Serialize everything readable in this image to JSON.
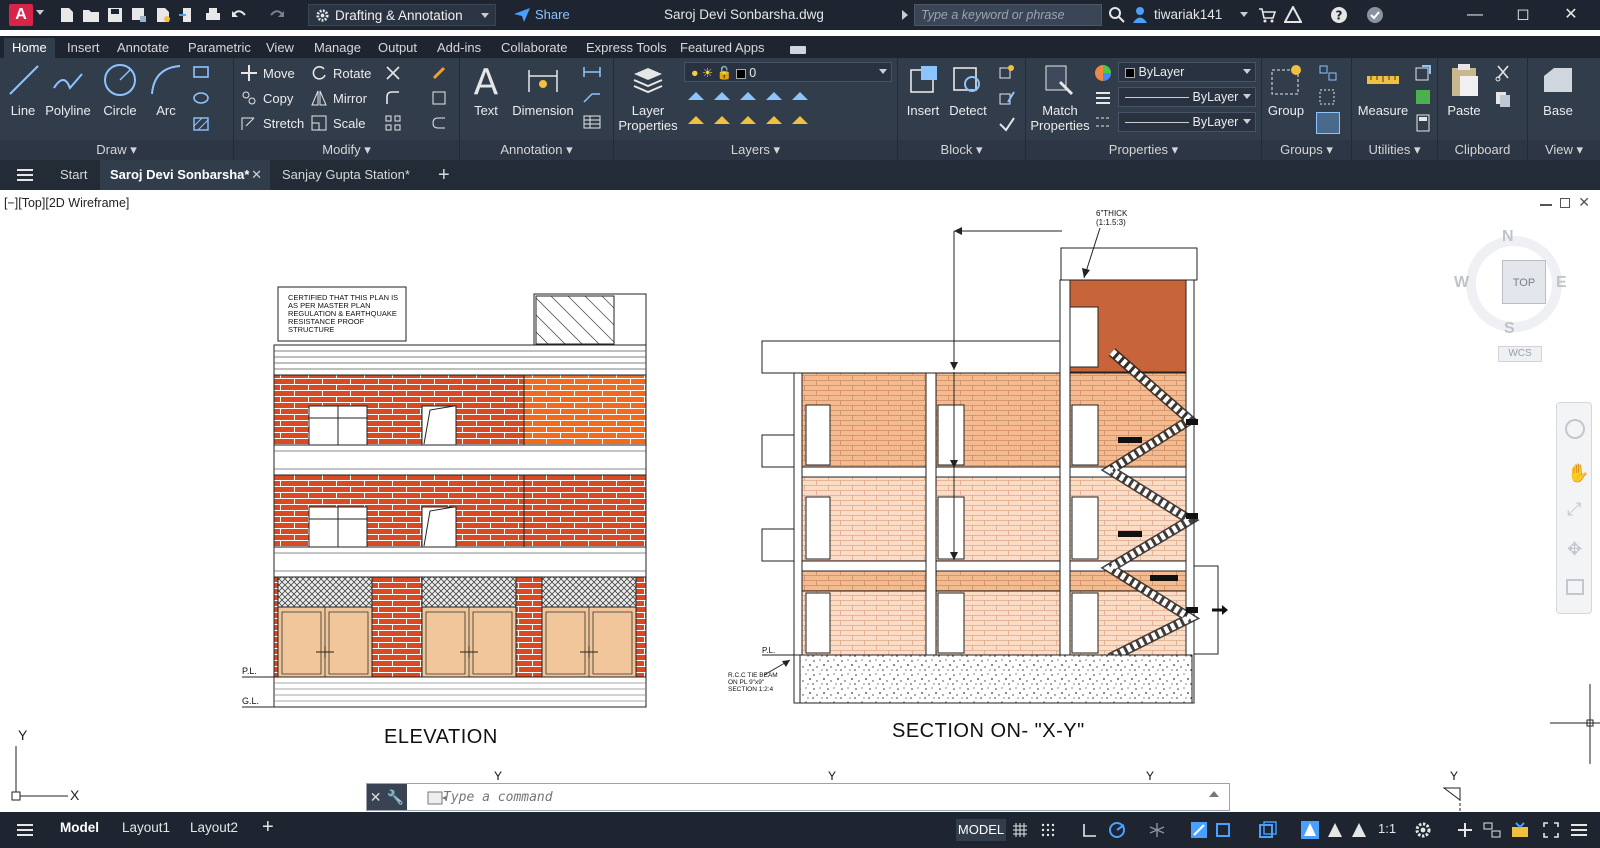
{
  "titlebar": {
    "app_logo": "A",
    "workspace": "Drafting & Annotation",
    "share_label": "Share",
    "document_title": "Saroj Devi Sonbarsha.dwg",
    "search_placeholder": "Type a keyword or phrase",
    "username": "tiwariak141"
  },
  "ribbon_tabs": [
    "Home",
    "Insert",
    "Annotate",
    "Parametric",
    "View",
    "Manage",
    "Output",
    "Add-ins",
    "Collaborate",
    "Express Tools",
    "Featured Apps"
  ],
  "draw": {
    "title": "Draw",
    "line": "Line",
    "polyline": "Polyline",
    "circle": "Circle",
    "arc": "Arc"
  },
  "modify": {
    "title": "Modify",
    "move": "Move",
    "rotate": "Rotate",
    "copy": "Copy",
    "mirror": "Mirror",
    "stretch": "Stretch",
    "scale": "Scale"
  },
  "annotation": {
    "title": "Annotation",
    "text": "Text",
    "dimension": "Dimension"
  },
  "layers": {
    "title": "Layers",
    "layer_properties_1": "Layer",
    "layer_properties_2": "Properties",
    "current_layer": "0"
  },
  "block": {
    "title": "Block",
    "insert": "Insert",
    "detect": "Detect"
  },
  "properties": {
    "title": "Properties",
    "match_1": "Match",
    "match_2": "Properties",
    "color": "ByLayer",
    "linetype": "ByLayer",
    "lineweight": "ByLayer"
  },
  "groups": {
    "title": "Groups",
    "group": "Group"
  },
  "utilities": {
    "title": "Utilities",
    "measure": "Measure"
  },
  "clipboard": {
    "title": "Clipboard",
    "paste": "Paste"
  },
  "view_panel": {
    "title": "View",
    "base": "Base"
  },
  "file_tabs": {
    "start": "Start",
    "active": "Saroj Devi Sonbarsha*",
    "other": "Sanjay Gupta Station*"
  },
  "viewport": {
    "label": "[−][Top][2D Wireframe]",
    "cube_top": "TOP",
    "north": "N",
    "south": "S",
    "east": "E",
    "west": "W",
    "wcs": "WCS"
  },
  "drawing": {
    "elevation_title": "ELEVATION",
    "section_title": "SECTION ON- \"X-Y\"",
    "certified_note_1": "CERTIFIED THAT THIS PLAN IS",
    "certified_note_2": "AS PER MASTER PLAN",
    "certified_note_3": "REGULATION & EARTHQUAKE",
    "certified_note_4": "RESISTANCE PROOF",
    "certified_note_5": "STRUCTURE",
    "pl_label": "P.L.",
    "gl_label": "G.L.",
    "pl_label_section": "P.L.",
    "slab_note_1": "6\"THICK",
    "slab_note_2": "(1:1.5:3)",
    "tie_beam_1": "R.C.C TIE BEAM",
    "tie_beam_2": "ON PL 9\"x9\"",
    "tie_beam_3": "SECTION 1:2:4",
    "y_axis": "Y",
    "x_axis": "X",
    "y_marker": "Y"
  },
  "command": {
    "placeholder": "Type a command"
  },
  "status": {
    "model": "Model",
    "layout1": "Layout1",
    "layout2": "Layout2",
    "model_btn": "MODEL",
    "scale": "1:1"
  }
}
